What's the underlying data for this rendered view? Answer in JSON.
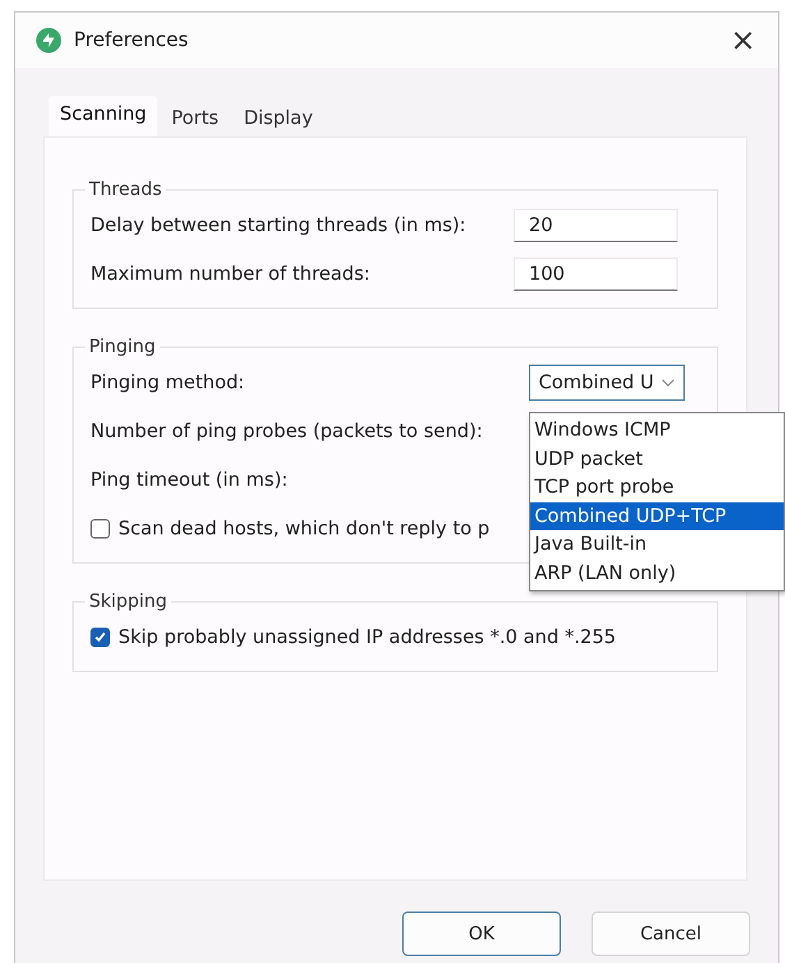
{
  "window": {
    "title": "Preferences",
    "close": "×"
  },
  "tabs": [
    {
      "label": "Scanning",
      "selected": true
    },
    {
      "label": "Ports",
      "selected": false
    },
    {
      "label": "Display",
      "selected": false
    }
  ],
  "threads": {
    "title": "Threads",
    "fields": [
      {
        "label": "Delay between starting threads (in ms):",
        "value": "20"
      },
      {
        "label": "Maximum number of threads:",
        "value": "100"
      }
    ]
  },
  "pinging": {
    "title": "Pinging",
    "method_label": "Pinging method:",
    "method": {
      "value": "Combined U",
      "expanded": true,
      "options": [
        {
          "label": "Windows ICMP",
          "selected": false
        },
        {
          "label": "UDP packet",
          "selected": false
        },
        {
          "label": "TCP port probe",
          "selected": false
        },
        {
          "label": "Combined UDP+TCP",
          "selected": true
        },
        {
          "label": "Java Built-in",
          "selected": false
        },
        {
          "label": "ARP (LAN only)",
          "selected": false
        }
      ]
    },
    "probes_label": "Number of ping probes (packets to send):",
    "timeout_label": "Ping timeout (in ms):",
    "dead_hosts": {
      "label": "Scan dead hosts, which don't reply to p",
      "checked": false
    }
  },
  "skipping": {
    "title": "Skipping",
    "skip_unassigned": {
      "label": "Skip probably unassigned IP addresses *.0 and *.255",
      "checked": true
    }
  },
  "buttons": [
    {
      "label": "OK",
      "default": true
    },
    {
      "label": "Cancel",
      "default": false
    }
  ]
}
